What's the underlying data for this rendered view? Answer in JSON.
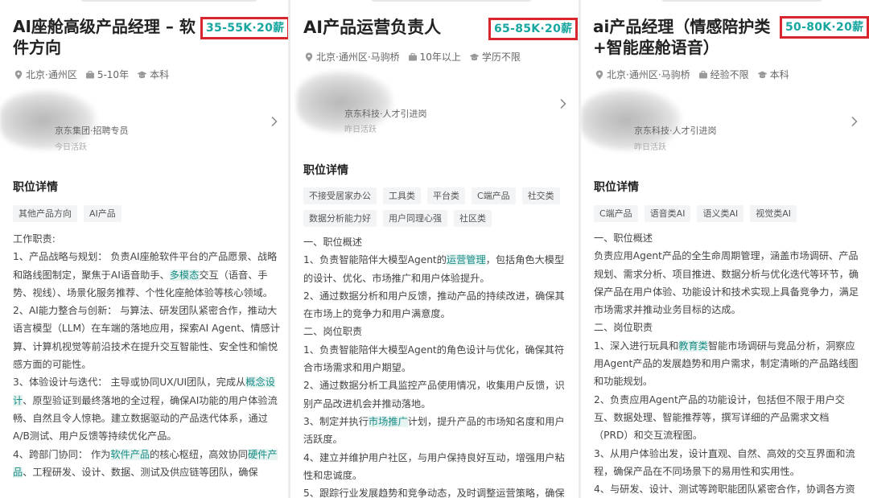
{
  "panels": [
    {
      "title": "AI座舱高级产品经理 – 软件方向",
      "salary": "35-55K·20薪",
      "location": "北京·通州区",
      "experience": "5-10年",
      "education": "本科",
      "hr_company": "京东集团·招聘专员",
      "hr_active": "今日活跃",
      "section_title": "职位详情",
      "tags": [
        "其他产品方向",
        "AI产品"
      ],
      "desc": [
        {
          "t": "工作职责:"
        },
        {
          "t": "1、产品战略与规划： 负责AI座舱软件平台的产品愿景、战略和路线图制定，聚焦于AI语音助手、",
          "h": "多模态",
          "a": "交互（语音、手势、视线）、场景化服务推荐、个性化座舱体验等核心领域。"
        },
        {
          "t": "2、AI能力整合与创新： 与算法、研发团队紧密合作，推动大语言模型（LLM）在车端的落地应用，探索AI Agent、情感计算、计算机视觉等前沿技术在提升交互智能性、安全性和愉悦感方面的可能性。"
        },
        {
          "t": "3、体验设计与迭代： 主导或协同UX/UI团队，完成从",
          "h": "概念设计",
          "a": "、原型验证到最终落地的全过程，确保AI功能的用户体验流畅、自然且令人惊艳。建立数据驱动的产品迭代体系，通过A/B测试、用户反馈等持续优化产品。"
        },
        {
          "t": "4、跨部门协同： 作为",
          "h": "软件产品",
          "a": "的核心枢纽，高效协同",
          "h2": "硬件产品",
          "a2": "、工程研发、设计、数据、测试及供应链等团队，确保"
        }
      ]
    },
    {
      "title": "AI产品运营负责人",
      "salary": "65-85K·20薪",
      "location": "北京·通州区·马驹桥",
      "experience": "10年以上",
      "education": "学历不限",
      "hr_company": "京东科技·人才引进岗",
      "hr_active": "昨日活跃",
      "section_title": "职位详情",
      "tags": [
        "不接受居家办公",
        "工具类",
        "平台类",
        "C端产品",
        "社交类",
        "数据分析能力好",
        "用户同理心强",
        "社区类"
      ],
      "desc": [
        {
          "t": "一、职位概述"
        },
        {
          "t": "1、负责智能陪伴大模型Agent的",
          "h": "运营管理",
          "a": "，包括角色大模型的设计、优化、市场推广和用户体验提升。"
        },
        {
          "t": "2、通过数据分析和用户反馈，推动产品的持续改进，确保其在市场上的竞争力和用户满意度。"
        },
        {
          "t": "二、岗位职责"
        },
        {
          "t": "1、负责智能陪伴大模型Agent的角色设计与优化，确保其符合市场需求和用户期望。"
        },
        {
          "t": "2、通过数据分析工具监控产品使用情况，收集用户反馈，识别产品改进机会并推动落地。"
        },
        {
          "t": "3、制定并执行",
          "h": "市场推广",
          "a": "计划，提升产品的市场知名度和用户活跃度。"
        },
        {
          "t": "4、建立并维护用户社区，与用户保持良好互动，增强用户粘性和忠诚度。"
        },
        {
          "t": "5、跟踪行业发展趋势和竞争动态，及时调整运营策略，确保"
        }
      ]
    },
    {
      "title": "ai产品经理（情感陪护类+智能座舱语音）",
      "salary": "50-80K·20薪",
      "location": "北京·通州区·马驹桥",
      "experience": "经验不限",
      "education": "本科",
      "hr_company": "京东科技·人才引进岗",
      "hr_active": "昨日活跃",
      "section_title": "职位详情",
      "tags": [
        "C端产品",
        "语音类AI",
        "语义类AI",
        "视觉类AI"
      ],
      "desc": [
        {
          "t": "一、职位概述"
        },
        {
          "t": "负责应用Agent产品的全生命周期管理，涵盖市场调研、产品规划、需求分析、项目推进、数据分析与优化迭代等环节，确保产品在用户体验、功能设计和技术实现上具备竞争力，满足市场需求并推动业务目标的达成。"
        },
        {
          "t": "二、岗位职责"
        },
        {
          "t": "1、深入进行玩具和",
          "h": "教育类",
          "a": "智能市场调研与竞品分析，洞察应用Agent产品的发展趋势和用户需求，制定清晰的产品路线图和功能规划。"
        },
        {
          "t": "2、负责应用Agent产品的功能设计，包括但不限于用户交互、数据处理、智能推荐等，撰写详细的产品需求文档（PRD）和交互流程图。"
        },
        {
          "t": "3、从用户体验出发，设计直观、自然、高效的交互界面和流程，确保产品在不同场景下的易用性和实用性。"
        },
        {
          "t": "4、与研发、设计、测试等跨职能团队紧密合作，协调各方资"
        }
      ]
    }
  ],
  "colors": {
    "salary": "#17a6a0",
    "highlight_box": "#d8262c",
    "link": "#1a8c86"
  }
}
